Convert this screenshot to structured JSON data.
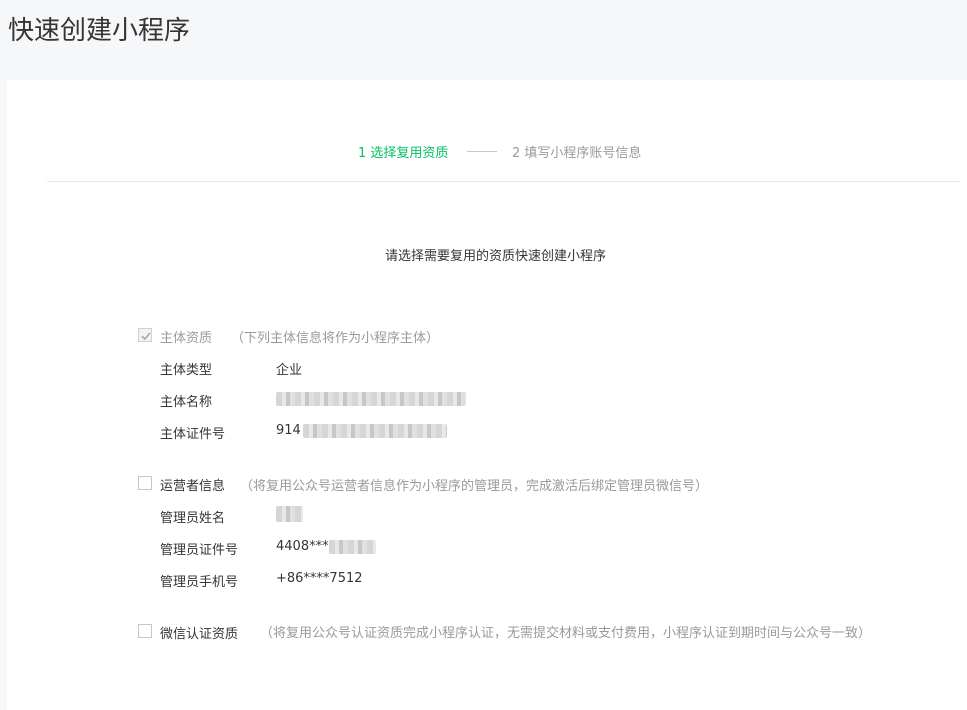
{
  "page": {
    "title": "快速创建小程序"
  },
  "steps": {
    "step1": "1 选择复用资质",
    "step2": "2 填写小程序账号信息",
    "active_color": "#07c160"
  },
  "subtitle": "请选择需要复用的资质快速创建小程序",
  "sections": {
    "entity": {
      "checked": true,
      "disabled": true,
      "title": "主体资质",
      "note": "（下列主体信息将作为小程序主体）",
      "rows": [
        {
          "label": "主体类型",
          "value": "企业"
        },
        {
          "label": "主体名称",
          "value": ""
        },
        {
          "label": "主体证件号",
          "value": "914"
        }
      ]
    },
    "operator": {
      "checked": false,
      "title": "运营者信息",
      "note": "（将复用公众号运营者信息作为小程序的管理员，完成激活后绑定管理员微信号）",
      "rows": [
        {
          "label": "管理员姓名",
          "value": ""
        },
        {
          "label": "管理员证件号",
          "value": "4408***"
        },
        {
          "label": "管理员手机号",
          "value": "+86****7512"
        }
      ]
    },
    "wechat_cert": {
      "checked": false,
      "title": "微信认证资质",
      "note": "（将复用公众号认证资质完成小程序认证，无需提交材料或支付费用，小程序认证到期时间与公众号一致）"
    }
  }
}
